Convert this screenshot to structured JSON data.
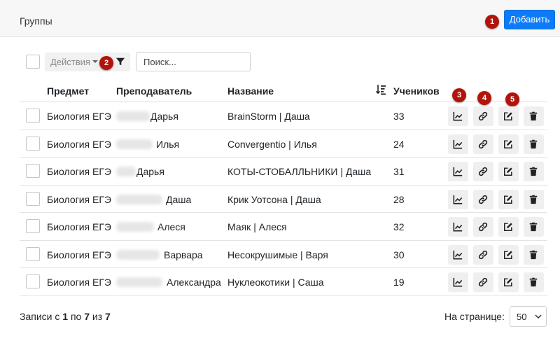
{
  "header": {
    "title": "Группы",
    "add_label": "Добавить"
  },
  "markers": [
    "1",
    "2",
    "3",
    "4",
    "5"
  ],
  "toolbar": {
    "actions_label": "Действия",
    "search_placeholder": "Поиск..."
  },
  "columns": {
    "subject": "Предмет",
    "teacher": "Преподаватель",
    "name": "Название",
    "students": "Учеников"
  },
  "rows": [
    {
      "subject": "Биология ЕГЭ",
      "teacher": "Дарья",
      "name": "BrainStorm | Даша",
      "students": "33"
    },
    {
      "subject": "Биология ЕГЭ",
      "teacher": "Илья",
      "name": "Convergentio | Илья",
      "students": "24"
    },
    {
      "subject": "Биология ЕГЭ",
      "teacher": "Дарья",
      "name": "КОТЫ-СТОБАЛЛЬНИКИ | Даша",
      "students": "31"
    },
    {
      "subject": "Биология ЕГЭ",
      "teacher": "Даша",
      "name": "Крик Уотсона | Даша",
      "students": "28"
    },
    {
      "subject": "Биология ЕГЭ",
      "teacher": "Алеся",
      "name": "Маяк | Алеся",
      "students": "32"
    },
    {
      "subject": "Биология ЕГЭ",
      "teacher": "Варвара",
      "name": "Несокрушимые | Варя",
      "students": "30"
    },
    {
      "subject": "Биология ЕГЭ",
      "teacher": "Александра",
      "name": "Нуклеокотики | Саша",
      "students": "19"
    }
  ],
  "footer": {
    "records_prefix": "Записи с",
    "from": "1",
    "to_word": "по",
    "to": "7",
    "of_word": "из",
    "total": "7",
    "per_page_label": "На странице:",
    "per_page_value": "50"
  },
  "icons": [
    "filter-icon",
    "sort-icon",
    "chart-icon",
    "link-icon",
    "edit-icon",
    "trash-icon",
    "chevron-down-icon"
  ],
  "colors": {
    "primary": "#0d7bf7",
    "marker": "#b2140c"
  }
}
